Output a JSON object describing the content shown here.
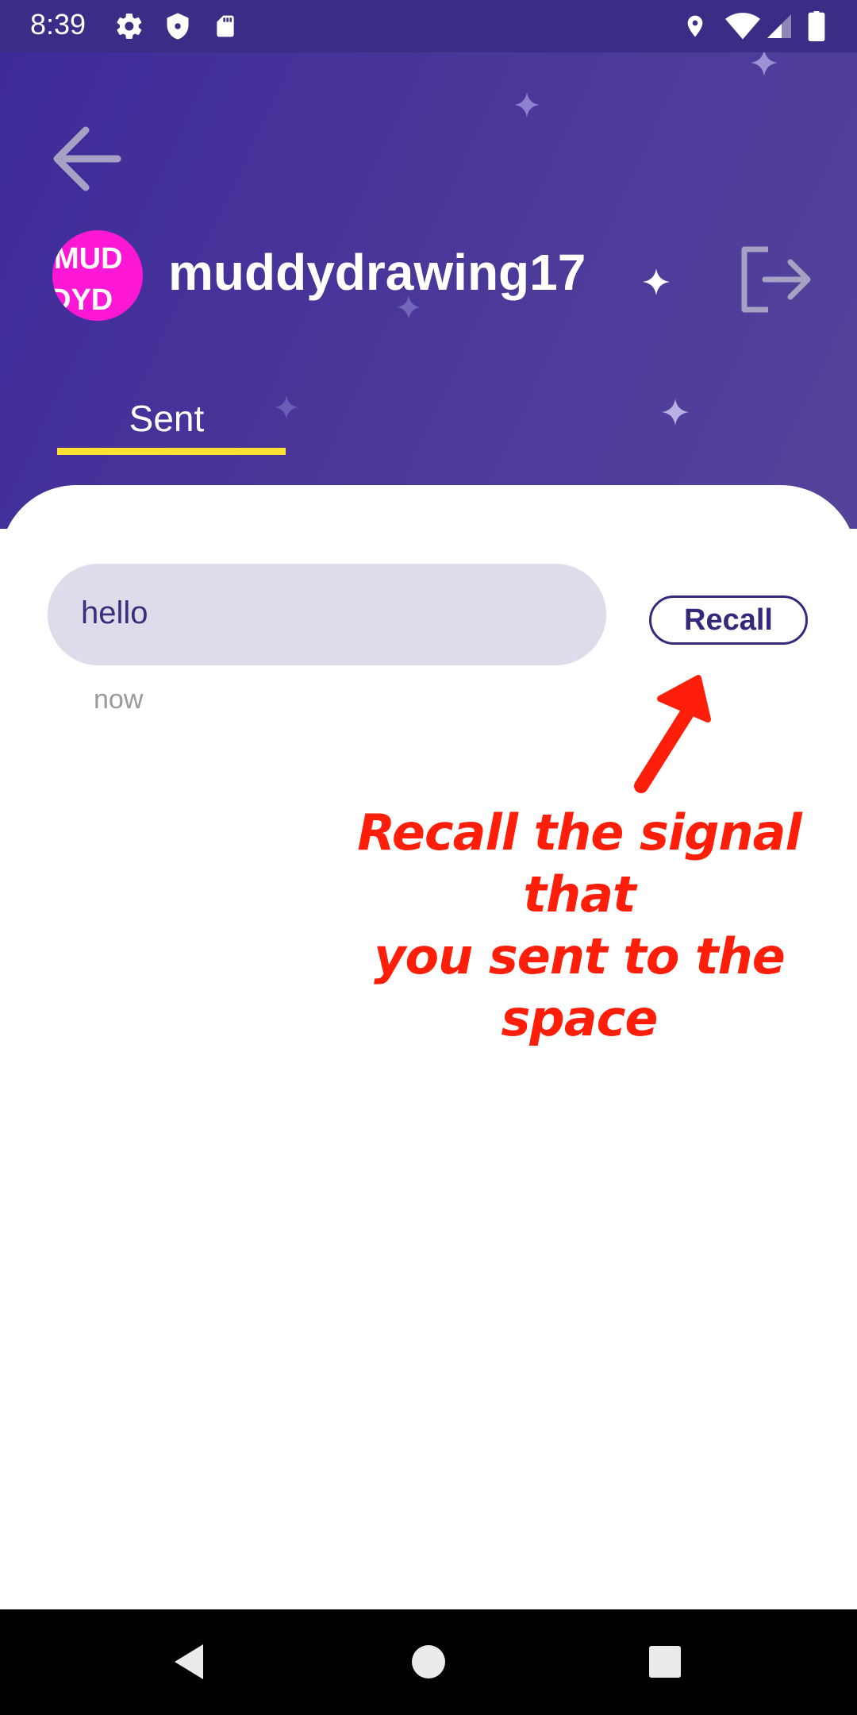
{
  "status_bar": {
    "time": "8:39",
    "icons_left": [
      "gear-icon",
      "shield-icon",
      "sd-card-icon"
    ],
    "icons_right": [
      "location-icon",
      "wifi-icon",
      "signal-icon",
      "battery-icon"
    ]
  },
  "header": {
    "back_icon": "arrow-left-icon",
    "avatar_text_line1": "MUD",
    "avatar_text_line2": "DYD",
    "avatar_color": "#ff17d6",
    "username": "muddydrawing17",
    "logout_icon": "logout-icon",
    "tabs": [
      {
        "label": "Sent",
        "active": true
      }
    ],
    "indicator_color": "#ffe033",
    "background_color": "#4a3699"
  },
  "messages": [
    {
      "text": "hello",
      "time": "now",
      "action_label": "Recall"
    }
  ],
  "annotation": {
    "line1": "Recall the signal that",
    "line2": "you sent to the space",
    "color": "#ff1e0a"
  },
  "nav_bar": {
    "buttons": [
      "back-triangle-icon",
      "home-circle-icon",
      "recents-square-icon"
    ]
  }
}
